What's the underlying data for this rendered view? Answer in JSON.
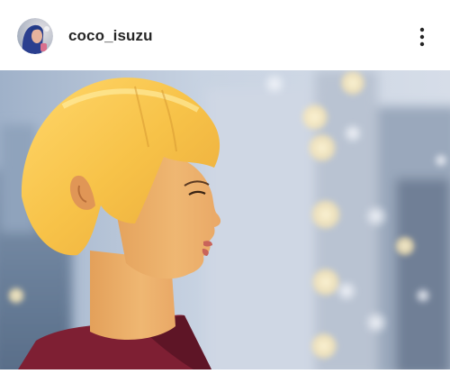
{
  "post": {
    "username": "coco_isuzu",
    "avatar_icon": "profile-avatar",
    "more_icon": "more-vertical-icon"
  },
  "colors": {
    "username_text": "#262626",
    "background": "#ffffff"
  }
}
